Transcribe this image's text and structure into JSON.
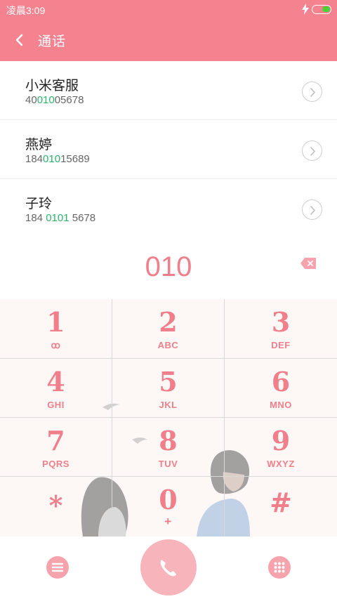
{
  "status_bar": {
    "time": "凌晨3:09",
    "charging_icon": "bolt-icon",
    "battery_color": "#4cd137"
  },
  "header": {
    "title": "通话",
    "back_icon": "chevron-left-icon"
  },
  "contacts": [
    {
      "name": "小米客服",
      "number_pre": "40",
      "number_match": "010",
      "number_post": "05678"
    },
    {
      "name": "燕婷",
      "number_pre": "184",
      "number_match": "010",
      "number_post": "15689"
    },
    {
      "name": "子玲",
      "number_pre": "184 ",
      "number_match": "0101",
      "number_post": " 5678"
    }
  ],
  "dialed": {
    "number": "010",
    "backspace_icon": "backspace-icon"
  },
  "keypad": [
    {
      "digit": "1",
      "letters": "ꝏ"
    },
    {
      "digit": "2",
      "letters": "ABC"
    },
    {
      "digit": "3",
      "letters": "DEF"
    },
    {
      "digit": "4",
      "letters": "GHI"
    },
    {
      "digit": "5",
      "letters": "JKL"
    },
    {
      "digit": "6",
      "letters": "MNO"
    },
    {
      "digit": "7",
      "letters": "PQRS"
    },
    {
      "digit": "8",
      "letters": "TUV"
    },
    {
      "digit": "9",
      "letters": "WXYZ"
    },
    {
      "digit": "*",
      "letters": ""
    },
    {
      "digit": "0",
      "letters": "+"
    },
    {
      "digit": "#",
      "letters": ""
    }
  ],
  "bottom_bar": {
    "menu_icon": "menu-icon",
    "call_icon": "phone-icon",
    "dialpad_icon": "dialpad-icon"
  },
  "colors": {
    "accent": "#f5828f",
    "digit": "#f07f8b",
    "match": "#2bb36a"
  }
}
